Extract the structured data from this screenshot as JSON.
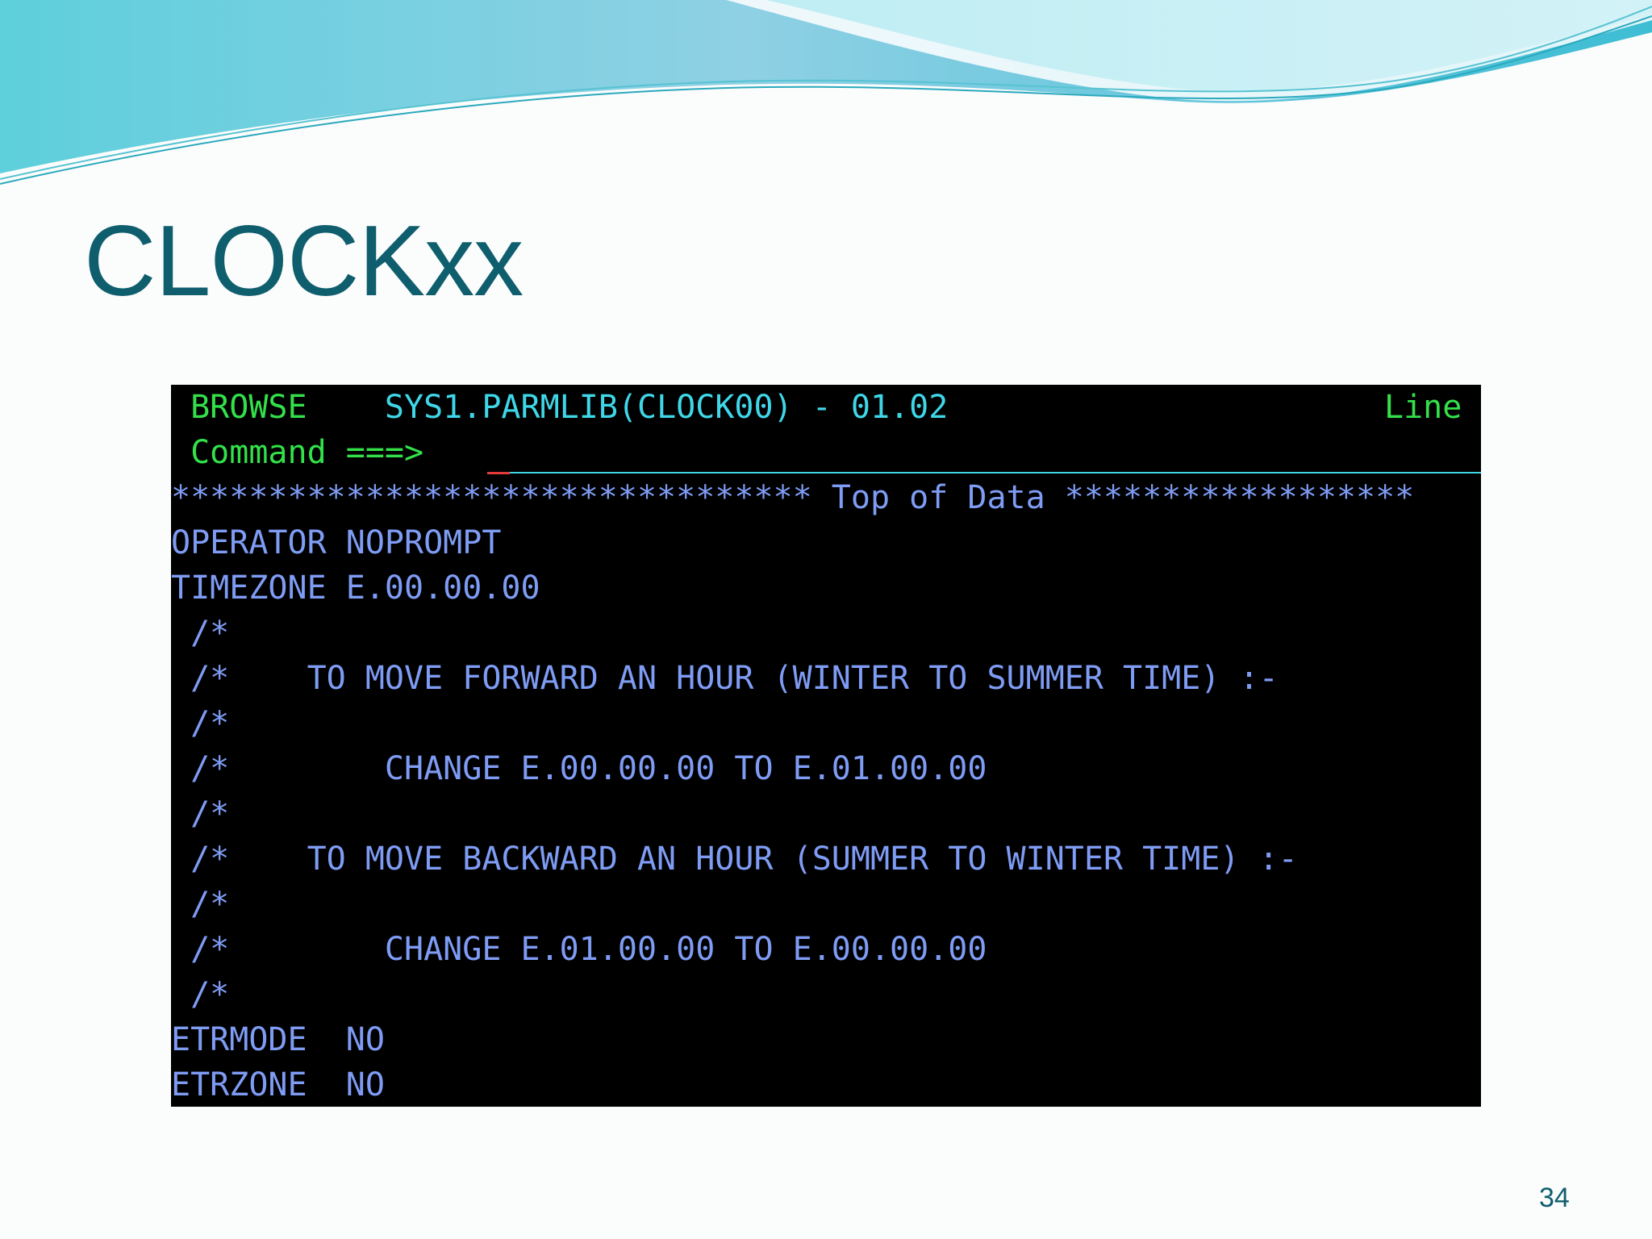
{
  "slide": {
    "title": "CLOCKxx",
    "page_number": "34"
  },
  "terminal": {
    "header": {
      "mode": "BROWSE",
      "dataset": "SYS1.PARMLIB(CLOCK00) - 01.02",
      "line_label": "Line"
    },
    "command": {
      "prompt": "Command ===>",
      "value": ""
    },
    "top_of_data": "********************************* Top of Data ******************",
    "lines": [
      "OPERATOR NOPROMPT",
      "TIMEZONE E.00.00.00",
      " /*",
      " /*    TO MOVE FORWARD AN HOUR (WINTER TO SUMMER TIME) :-",
      " /*",
      " /*        CHANGE E.00.00.00 TO E.01.00.00",
      " /*",
      " /*    TO MOVE BACKWARD AN HOUR (SUMMER TO WINTER TIME) :-",
      " /*",
      " /*        CHANGE E.01.00.00 TO E.00.00.00",
      " /*",
      "ETRMODE  NO",
      "ETRZONE  NO"
    ]
  },
  "colors": {
    "title": "#0f5e6e",
    "terminal_bg": "#000000",
    "green_field": "#33e04a",
    "cyan_field": "#3fd7e8",
    "blue_text": "#7f9cf5",
    "cursor": "#e33a3a"
  }
}
